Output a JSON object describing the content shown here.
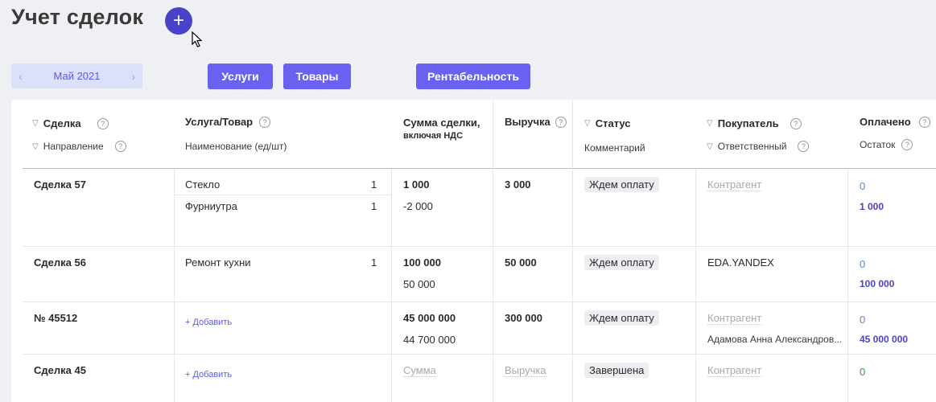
{
  "page": {
    "title": "Учет сделок"
  },
  "toolbar": {
    "add_label": "+",
    "month": "Май 2021",
    "services_label": "Услуги",
    "goods_label": "Товары",
    "profit_label": "Рентабельность"
  },
  "columns": {
    "deal": "Сделка",
    "direction": "Направление",
    "product": "Услуга/Товар",
    "product_name": "Наименование (ед/шт)",
    "sum": "Сумма сделки,",
    "sum2": "включая НДС",
    "revenue": "Выручка",
    "status": "Статус",
    "comment": "Комментарий",
    "buyer": "Покупатель",
    "responsible": "Ответственный",
    "paid": "Оплачено",
    "rest": "Остаток"
  },
  "rows": [
    {
      "deal": "Сделка 57",
      "items": [
        {
          "name": "Стекло",
          "qty": "1"
        },
        {
          "name": "Фурниутра",
          "qty": "1"
        }
      ],
      "sum": "1 000",
      "sum_sub": "-2 000",
      "revenue": "3 000",
      "status": "Ждем оплату",
      "buyer": "Контрагент",
      "paid": "0",
      "rest": "1 000"
    },
    {
      "deal": "Сделка 56",
      "items": [
        {
          "name": "Ремонт кухни",
          "qty": "1"
        }
      ],
      "sum": "100 000",
      "sum_sub": "50 000",
      "revenue": "50 000",
      "status": "Ждем оплату",
      "buyer": "EDA.YANDEX",
      "paid": "0",
      "rest": "100 000"
    },
    {
      "deal": "№ 45512",
      "add_label": "+ Добавить",
      "sum": "45 000 000",
      "sum_sub": "44 700 000",
      "revenue": "300 000",
      "status": "Ждем оплату",
      "buyer": "Контрагент",
      "responsible": "Адамова Анна Александров...",
      "paid": "0",
      "rest": "45 000 000"
    },
    {
      "deal": "Сделка 45",
      "add_label": "+ Добавить",
      "sum_placeholder": "Сумма",
      "revenue_placeholder": "Выручка",
      "status": "Завершена",
      "buyer": "Контрагент",
      "paid": "0"
    }
  ],
  "colors": {
    "accent": "#6a61f0",
    "accent_dark": "#4a42c9",
    "link": "#4e8ad8",
    "success": "#3c9a3c"
  }
}
